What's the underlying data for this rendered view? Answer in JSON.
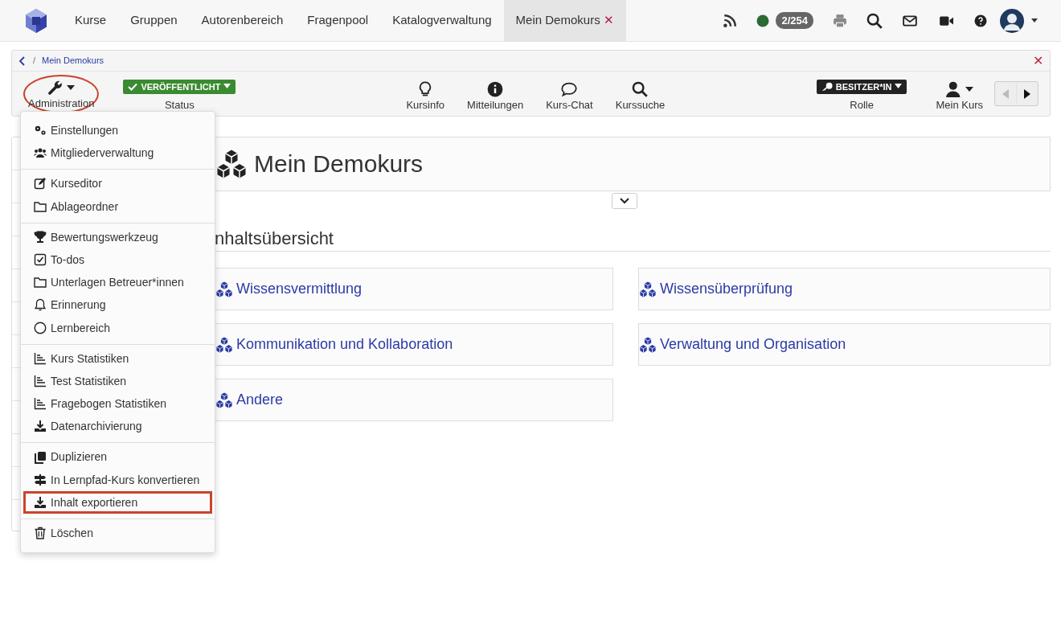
{
  "top_nav": {
    "tabs": [
      {
        "label": "Kurse",
        "selected": false
      },
      {
        "label": "Gruppen",
        "selected": false
      },
      {
        "label": "Autorenbereich",
        "selected": false
      },
      {
        "label": "Fragenpool",
        "selected": false
      },
      {
        "label": "Katalogverwaltung",
        "selected": false
      },
      {
        "label": "Mein Demokurs",
        "selected": true,
        "close": "✕"
      }
    ],
    "counter": "2/254"
  },
  "breadcrumb": {
    "separator": "/",
    "items": [
      "Mein Demokurs"
    ],
    "close": "✕"
  },
  "toolbar": {
    "left": [
      {
        "kind": "menu",
        "label": "Administration",
        "highlighted": true
      },
      {
        "kind": "badge",
        "badge": "VERÖFFENTLICHT",
        "label": "Status"
      }
    ],
    "center": [
      {
        "label": "Kursinfo"
      },
      {
        "label": "Mitteilungen"
      },
      {
        "label": "Kurs-Chat"
      },
      {
        "label": "Kurssuche"
      }
    ],
    "right": [
      {
        "kind": "badge",
        "badge": "BESITZER*IN",
        "label": "Rolle"
      },
      {
        "kind": "menu",
        "label": "Mein Kurs",
        "highlighted": false
      }
    ]
  },
  "admin_menu": {
    "groups": [
      [
        {
          "label": "Einstellungen",
          "highlighted": false
        },
        {
          "label": "Mitgliederverwaltung",
          "highlighted": false
        }
      ],
      [
        {
          "label": "Kurseditor",
          "highlighted": false
        },
        {
          "label": "Ablageordner",
          "highlighted": false
        }
      ],
      [
        {
          "label": "Bewertungswerkzeug",
          "highlighted": false
        },
        {
          "label": "To-dos",
          "highlighted": false
        },
        {
          "label": "Unterlagen Betreuer*innen",
          "highlighted": false
        },
        {
          "label": "Erinnerung",
          "highlighted": false
        },
        {
          "label": "Lernbereich",
          "highlighted": false
        }
      ],
      [
        {
          "label": "Kurs Statistiken",
          "highlighted": false
        },
        {
          "label": "Test Statistiken",
          "highlighted": false
        },
        {
          "label": "Fragebogen Statistiken",
          "highlighted": false
        },
        {
          "label": "Datenarchivierung",
          "highlighted": false
        }
      ],
      [
        {
          "label": "Duplizieren",
          "highlighted": false
        },
        {
          "label": "In Lernpfad-Kurs konvertieren",
          "highlighted": false
        },
        {
          "label": "Inhalt exportieren",
          "highlighted": true
        }
      ],
      [
        {
          "label": "Löschen",
          "highlighted": false
        }
      ]
    ]
  },
  "course": {
    "title": "Mein Demokurs",
    "overview_heading": "nhaltsübersicht",
    "tiles": [
      {
        "label": "Wissensvermittlung"
      },
      {
        "label": "Wissensüberprüfung"
      },
      {
        "label": "Kommunikation und Kollaboration"
      },
      {
        "label": "Verwaltung und Organisation"
      },
      {
        "label": "Andere"
      }
    ]
  }
}
